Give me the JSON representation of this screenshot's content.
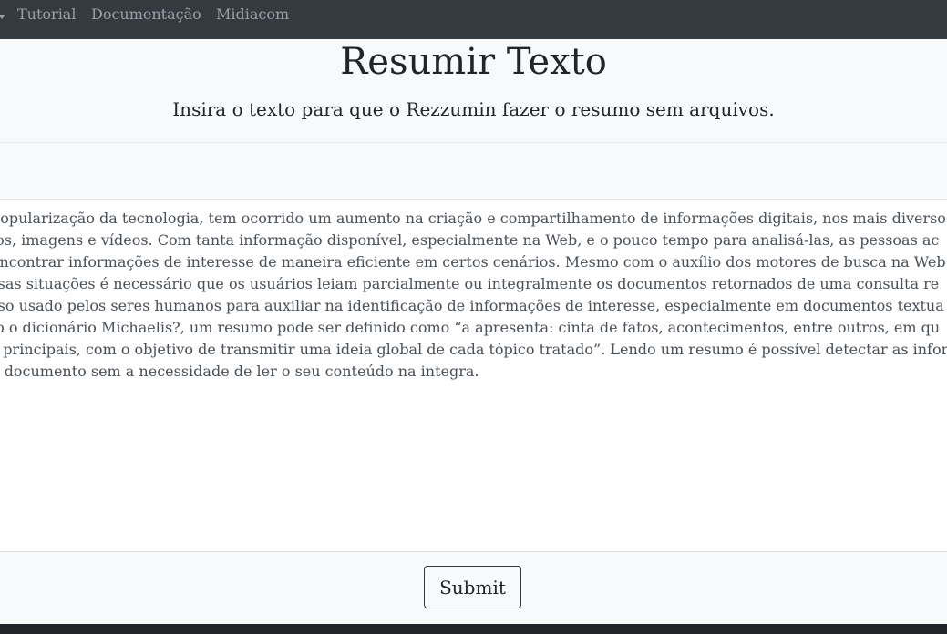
{
  "nav": {
    "links": [
      "Tutorial",
      "Documentação",
      "Midiacom"
    ]
  },
  "header": {
    "title": "Resumir Texto",
    "subtitle": "Insira o texto para que o Rezzumin fazer o resumo sem arquivos."
  },
  "editor": {
    "text": "popularização da tecnologia, tem ocorrido um aumento na criação e compartilhamento de informações digitais, nos mais diversos\nios, imagens e vídeos. Com tanta informação disponível, especialmente na Web, e o pouco tempo para analisá-las, as pessoas ac\nencontrar informações de interesse de maneira eficiente em certos cenários. Mesmo com o auxílio dos motores de busca na Web\nrsas situações é necessário que os usuários leiam parcialmente ou integralmente os documentos retornados de uma consulta re\nrso usado pelos seres humanos para auxiliar na identificação de informações de interesse, especialmente em documentos textua\nlo o dicionário Michaelis?, um resumo pode ser definido como “a apresenta: cinta de fatos, acontecimentos, entre outros, em qu\ns principais, com o objetivo de transmitir uma ideia global de cada tópico tratado”. Lendo um resumo é possível detectar as infor\na documento sem a necessidade de ler o seu conteúdo na integra."
  },
  "actions": {
    "submit_label": "Submit"
  }
}
